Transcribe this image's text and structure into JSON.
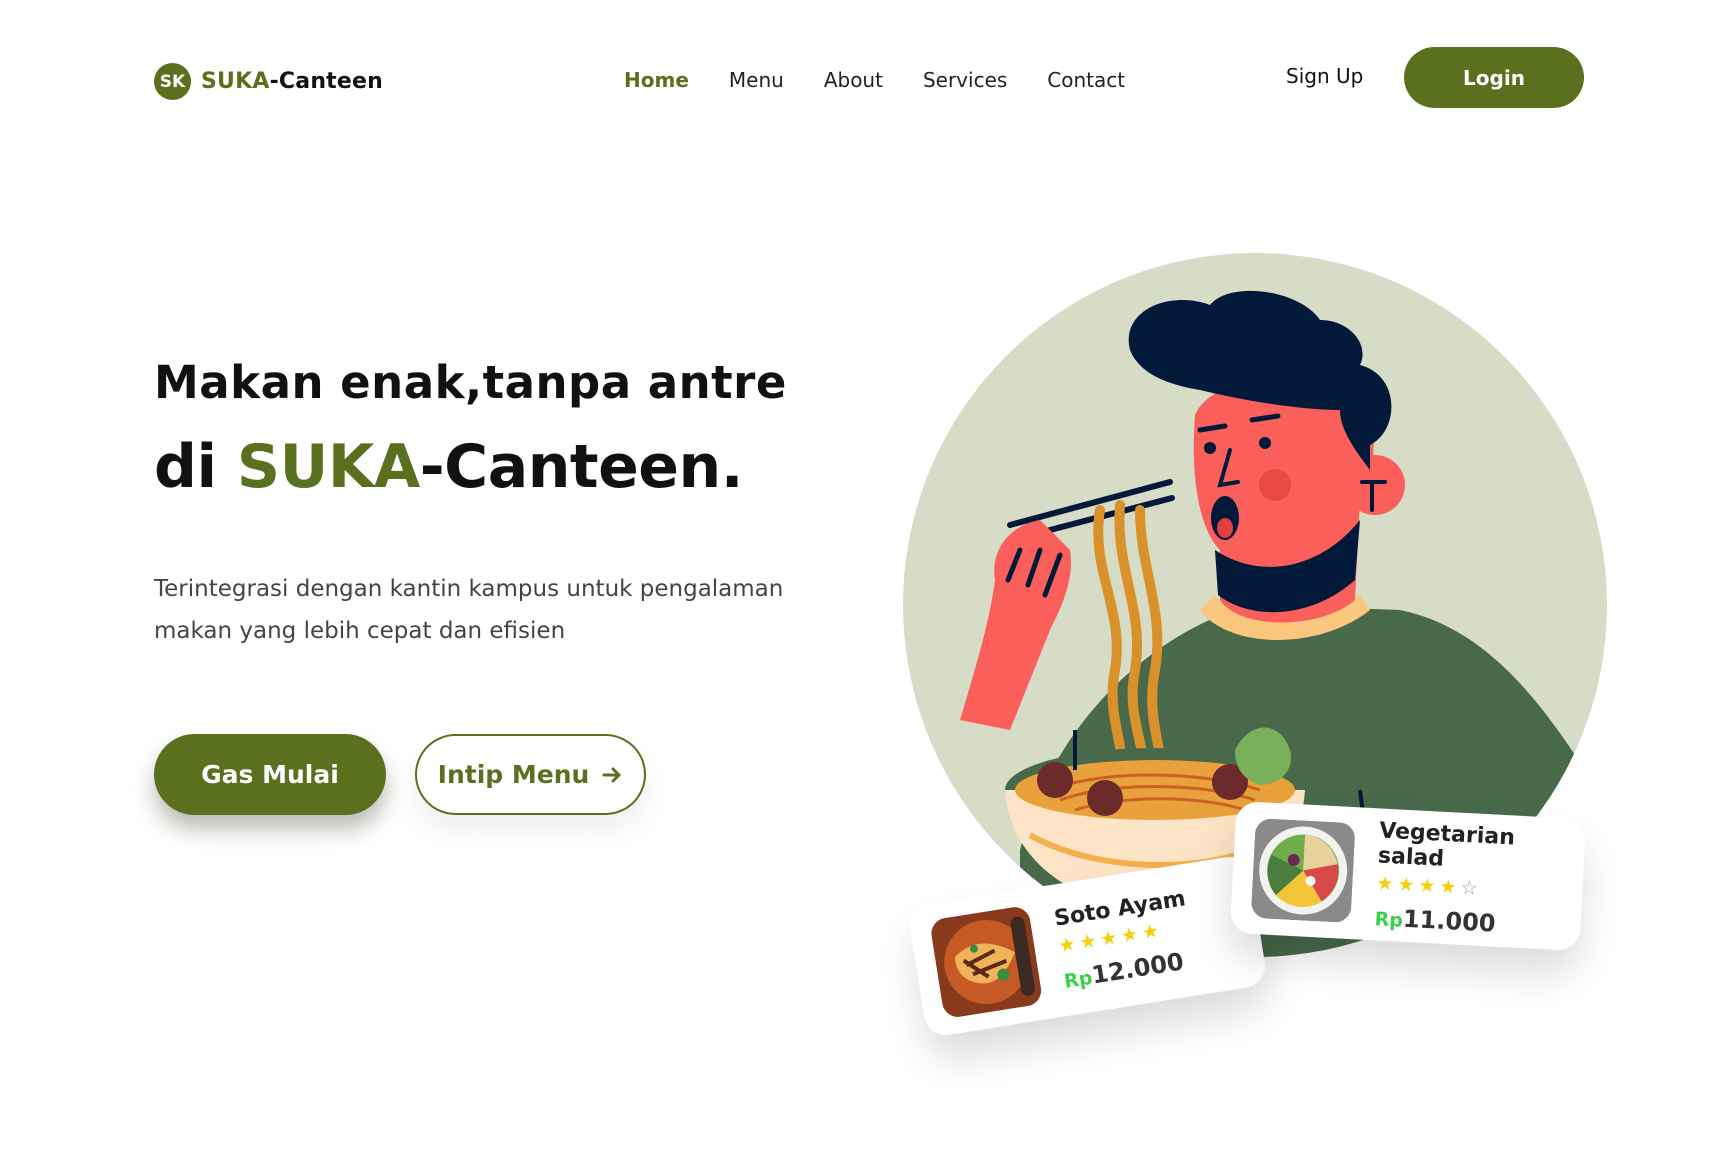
{
  "brand": {
    "logo_mark": "SK",
    "name_part1": "SUKA",
    "name_part2": "-Canteen"
  },
  "nav": {
    "items": [
      {
        "label": "Home",
        "active": true
      },
      {
        "label": "Menu",
        "active": false
      },
      {
        "label": "About",
        "active": false
      },
      {
        "label": "Services",
        "active": false
      },
      {
        "label": "Contact",
        "active": false
      }
    ],
    "signup_label": "Sign Up",
    "login_label": "Login"
  },
  "hero": {
    "line1": "Makan enak,tanpa antre",
    "line2_prefix": "di ",
    "line2_highlight": "SUKA",
    "line2_suffix": "-Canteen.",
    "description": "Terintegrasi dengan kantin kampus untuk pengalaman makan yang lebih cepat dan efisien",
    "primary_button": "Gas Mulai",
    "secondary_button": "Intip Menu",
    "secondary_icon": "arrow-right-icon"
  },
  "cards": [
    {
      "name": "Soto Ayam",
      "rating": 5,
      "currency": "Rp",
      "price": "12.000"
    },
    {
      "name": "Vegetarian salad",
      "rating": 4,
      "currency": "Rp",
      "price": "11.000"
    }
  ],
  "colors": {
    "primary": "#5b701e",
    "star": "#f6cf0c",
    "currency": "#3ad14a",
    "circle_bg": "#d6dcc6"
  }
}
